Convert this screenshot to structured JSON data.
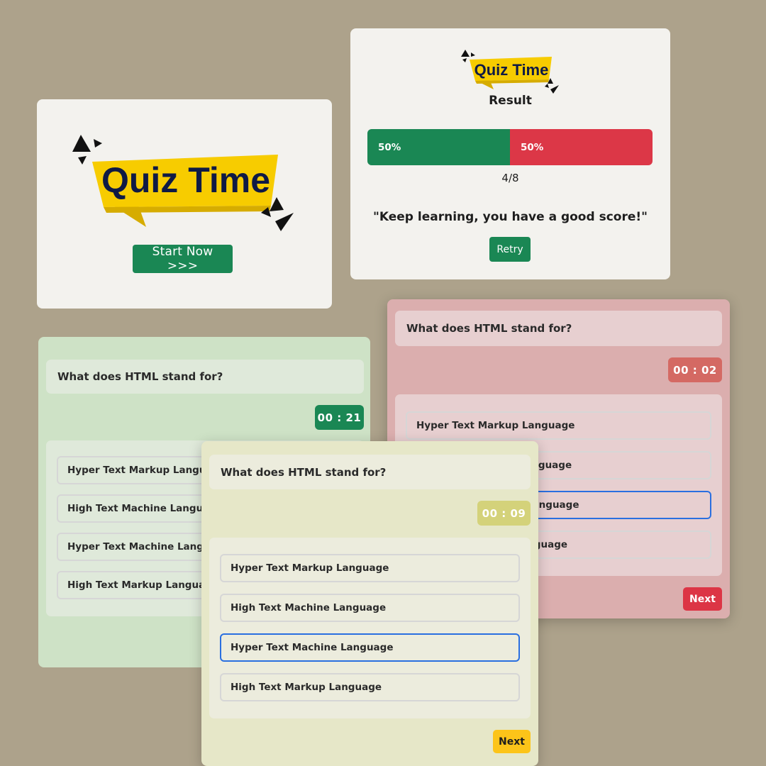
{
  "colors": {
    "background": "#ada28b",
    "primary_green": "#1a8754",
    "danger_red": "#dc3545",
    "warning_yellow": "#fcc419",
    "logo_yellow": "#f7cc00",
    "logo_text": "#0f1a45"
  },
  "start_card": {
    "logo_text": "Quiz Time",
    "start_button": "Start Now >>>"
  },
  "result_card": {
    "logo_text": "Quiz Time",
    "title": "Result",
    "correct_percent_label": "50%",
    "wrong_percent_label": "50%",
    "correct_fraction": 0.5,
    "score": "4/8",
    "message": "\"Keep learning, you have a good score!\"",
    "retry_button": "Retry"
  },
  "quiz_green": {
    "question": "What does HTML stand for?",
    "timer": "00 : 21",
    "options": [
      "Hyper Text Markup Language",
      "High Text Machine Language",
      "Hyper Text Machine Language",
      "High Text Markup Language"
    ]
  },
  "quiz_red": {
    "question": "What does HTML stand for?",
    "timer": "00 : 02",
    "options": [
      "Hyper Text Markup Language",
      "High Text Machine Language",
      "Hyper Text Machine Language",
      "High Text Markup Language"
    ],
    "selected_index": 2,
    "next_button": "Next"
  },
  "quiz_yellow": {
    "question": "What does HTML stand for?",
    "timer": "00 : 09",
    "options": [
      "Hyper Text Markup Language",
      "High Text Machine Language",
      "Hyper Text Machine Language",
      "High Text Markup Language"
    ],
    "selected_index": 2,
    "next_button": "Next"
  }
}
